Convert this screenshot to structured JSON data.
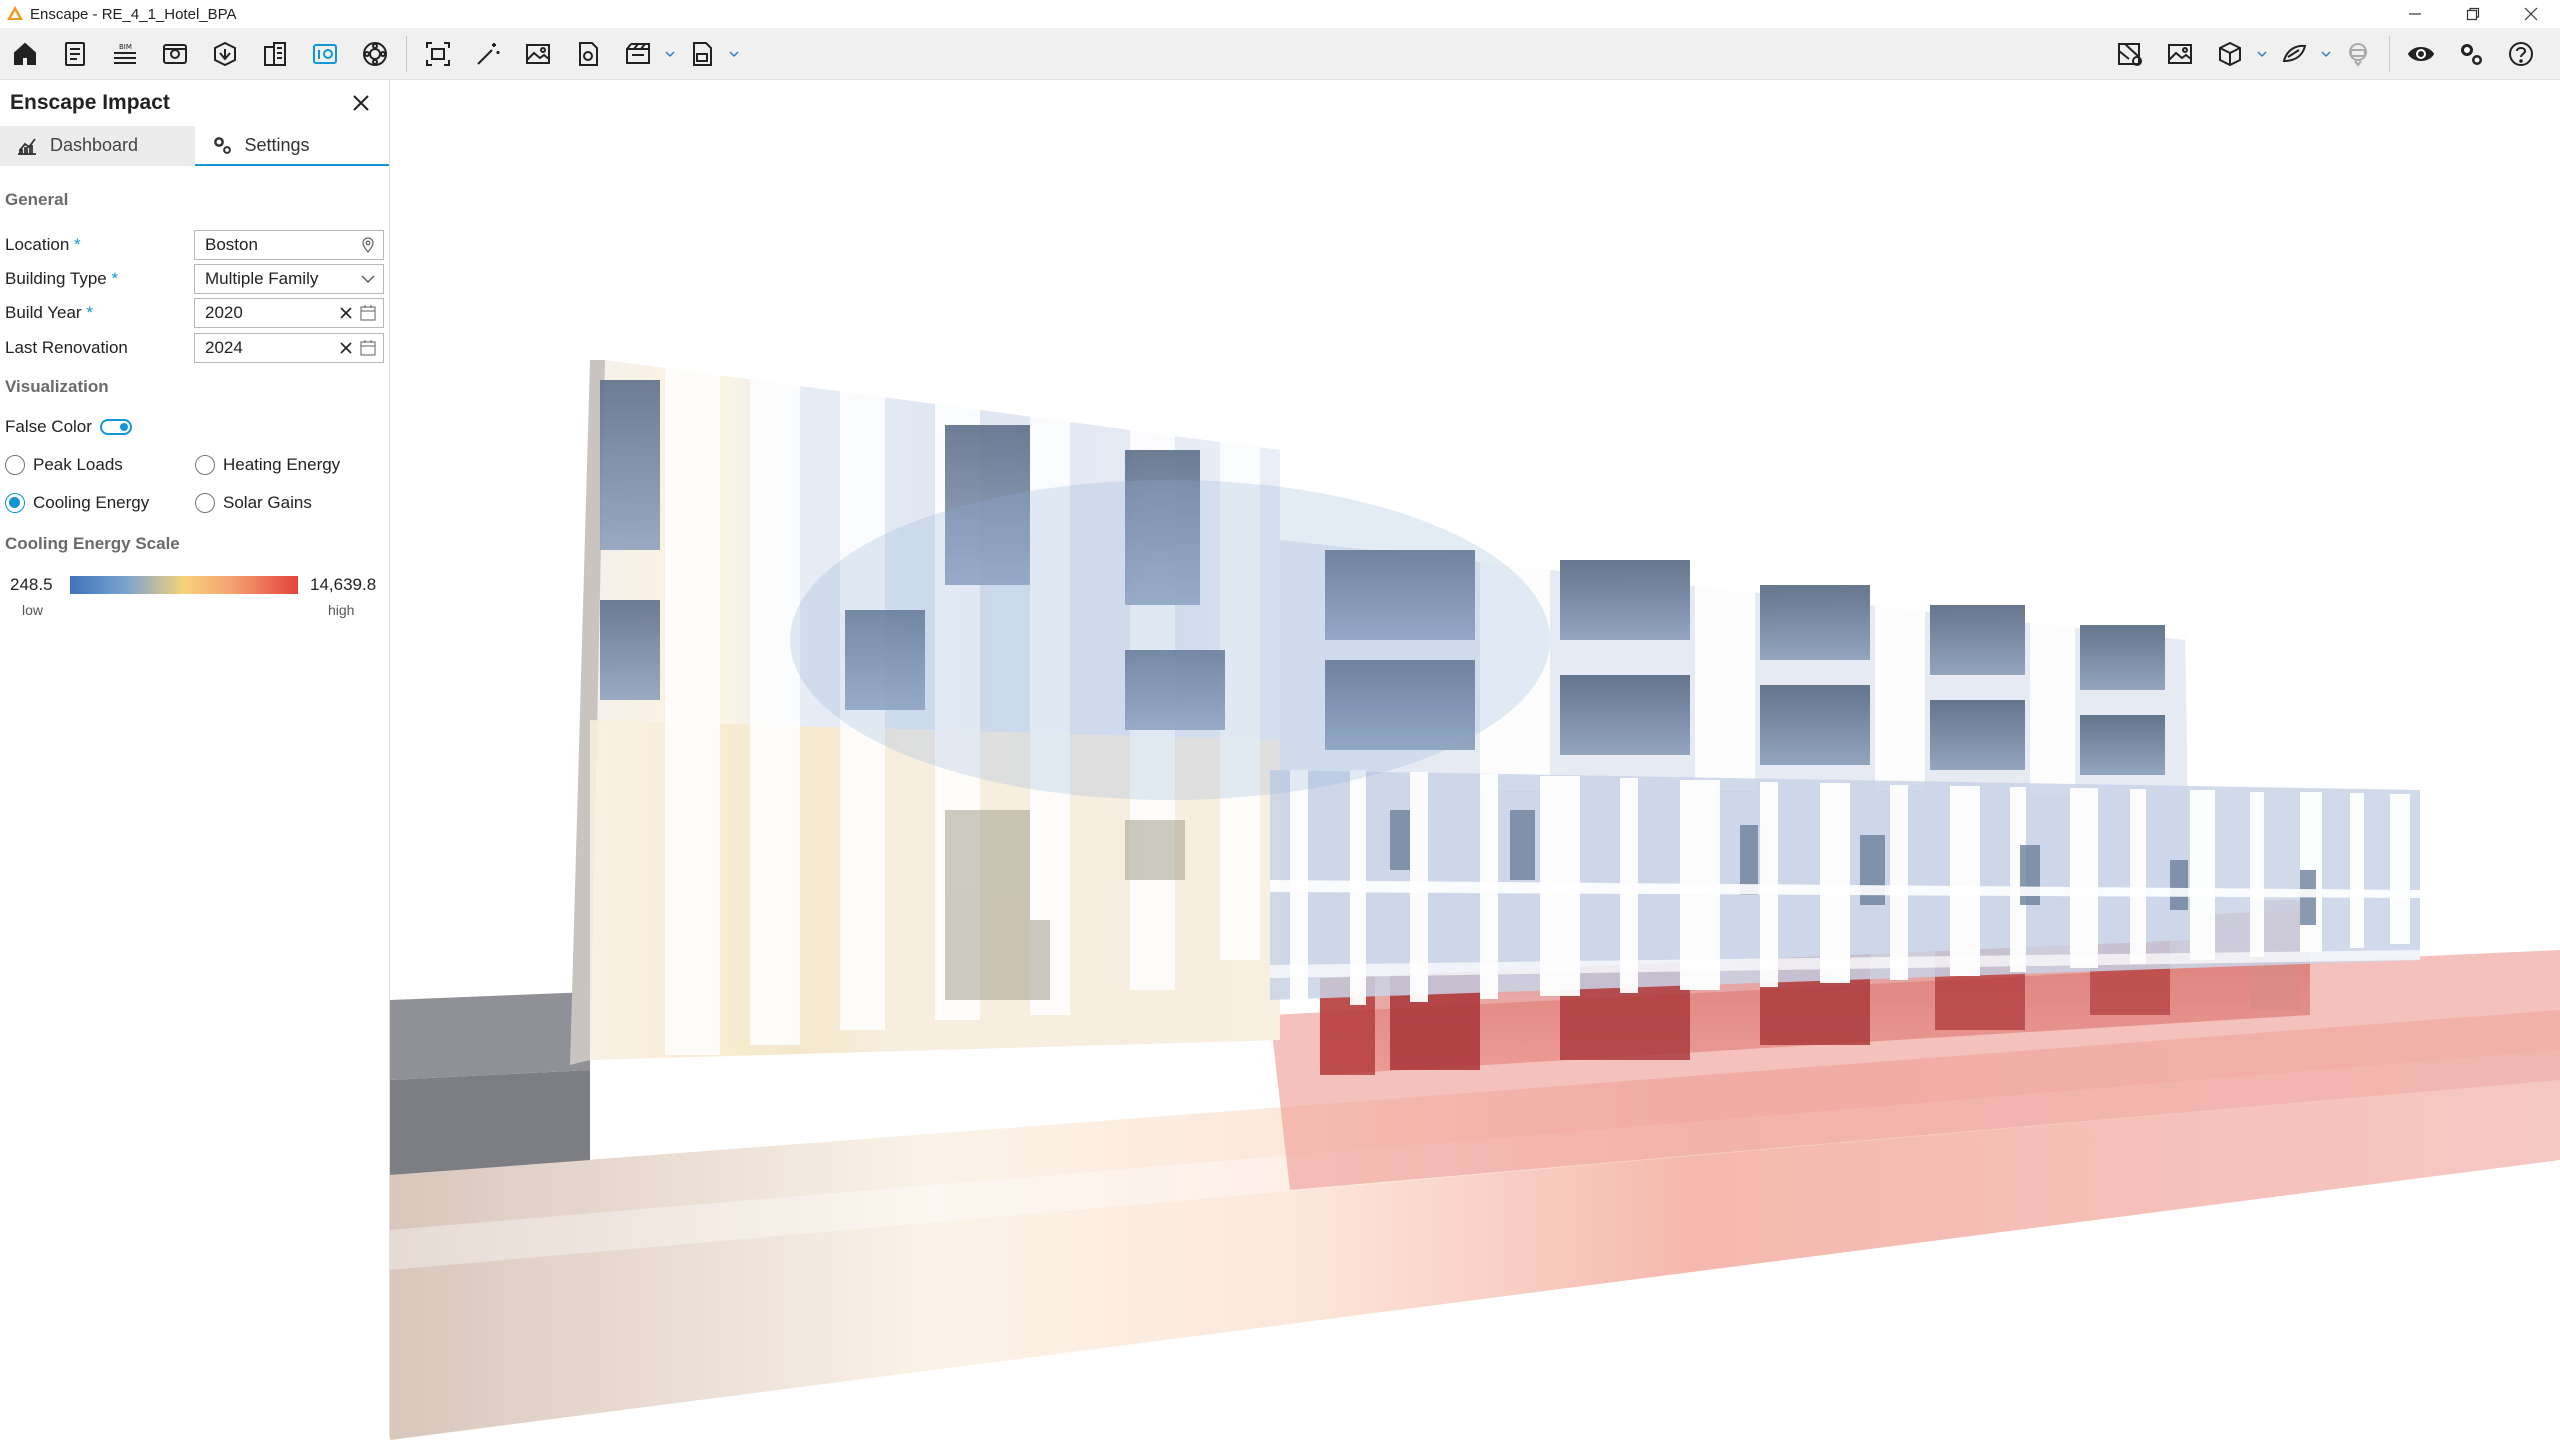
{
  "window": {
    "title": "Enscape - RE_4_1_Hotel_BPA"
  },
  "toolbar": {
    "left_icons": [
      "home-icon",
      "document-list-icon",
      "bim-icon",
      "view-icon",
      "asset-library-icon",
      "building-icon",
      "impact-icon",
      "materials-icon",
      "screenshot-icon",
      "magic-wand-icon",
      "image-icon",
      "video-icon",
      "batch-render-icon",
      "export-icon"
    ],
    "bim_label": "BIM",
    "right_icons": [
      "map-icon",
      "gallery-icon",
      "cube-icon",
      "sky-icon",
      "vr-headset-icon",
      "eye-icon",
      "settings-icon",
      "help-icon"
    ]
  },
  "panel": {
    "title": "Enscape Impact",
    "tabs": [
      {
        "label": "Dashboard",
        "active": false
      },
      {
        "label": "Settings",
        "active": true
      }
    ],
    "general": {
      "title": "General",
      "location": {
        "label": "Location",
        "required": "*",
        "value": "Boston"
      },
      "building_type": {
        "label": "Building Type",
        "required": "*",
        "value": "Multiple Family"
      },
      "build_year": {
        "label": "Build Year",
        "required": "*",
        "value": "2020"
      },
      "last_renovation": {
        "label": "Last Renovation",
        "value": "2024"
      }
    },
    "visualization": {
      "title": "Visualization",
      "false_color": {
        "label": "False Color",
        "on": true
      },
      "options": [
        {
          "label": "Peak Loads",
          "checked": false
        },
        {
          "label": "Heating Energy",
          "checked": false
        },
        {
          "label": "Cooling Energy",
          "checked": true
        },
        {
          "label": "Solar Gains",
          "checked": false
        }
      ]
    },
    "scale": {
      "title": "Cooling Energy Scale",
      "min": "248.5",
      "max": "14,639.8",
      "low_label": "low",
      "high_label": "high",
      "colors": [
        "#3f74b8",
        "#7ba4cf",
        "#f6d37a",
        "#f3a070",
        "#e6423b"
      ]
    }
  },
  "colors": {
    "accent": "#1296d6",
    "logo": "#f29a1f"
  }
}
